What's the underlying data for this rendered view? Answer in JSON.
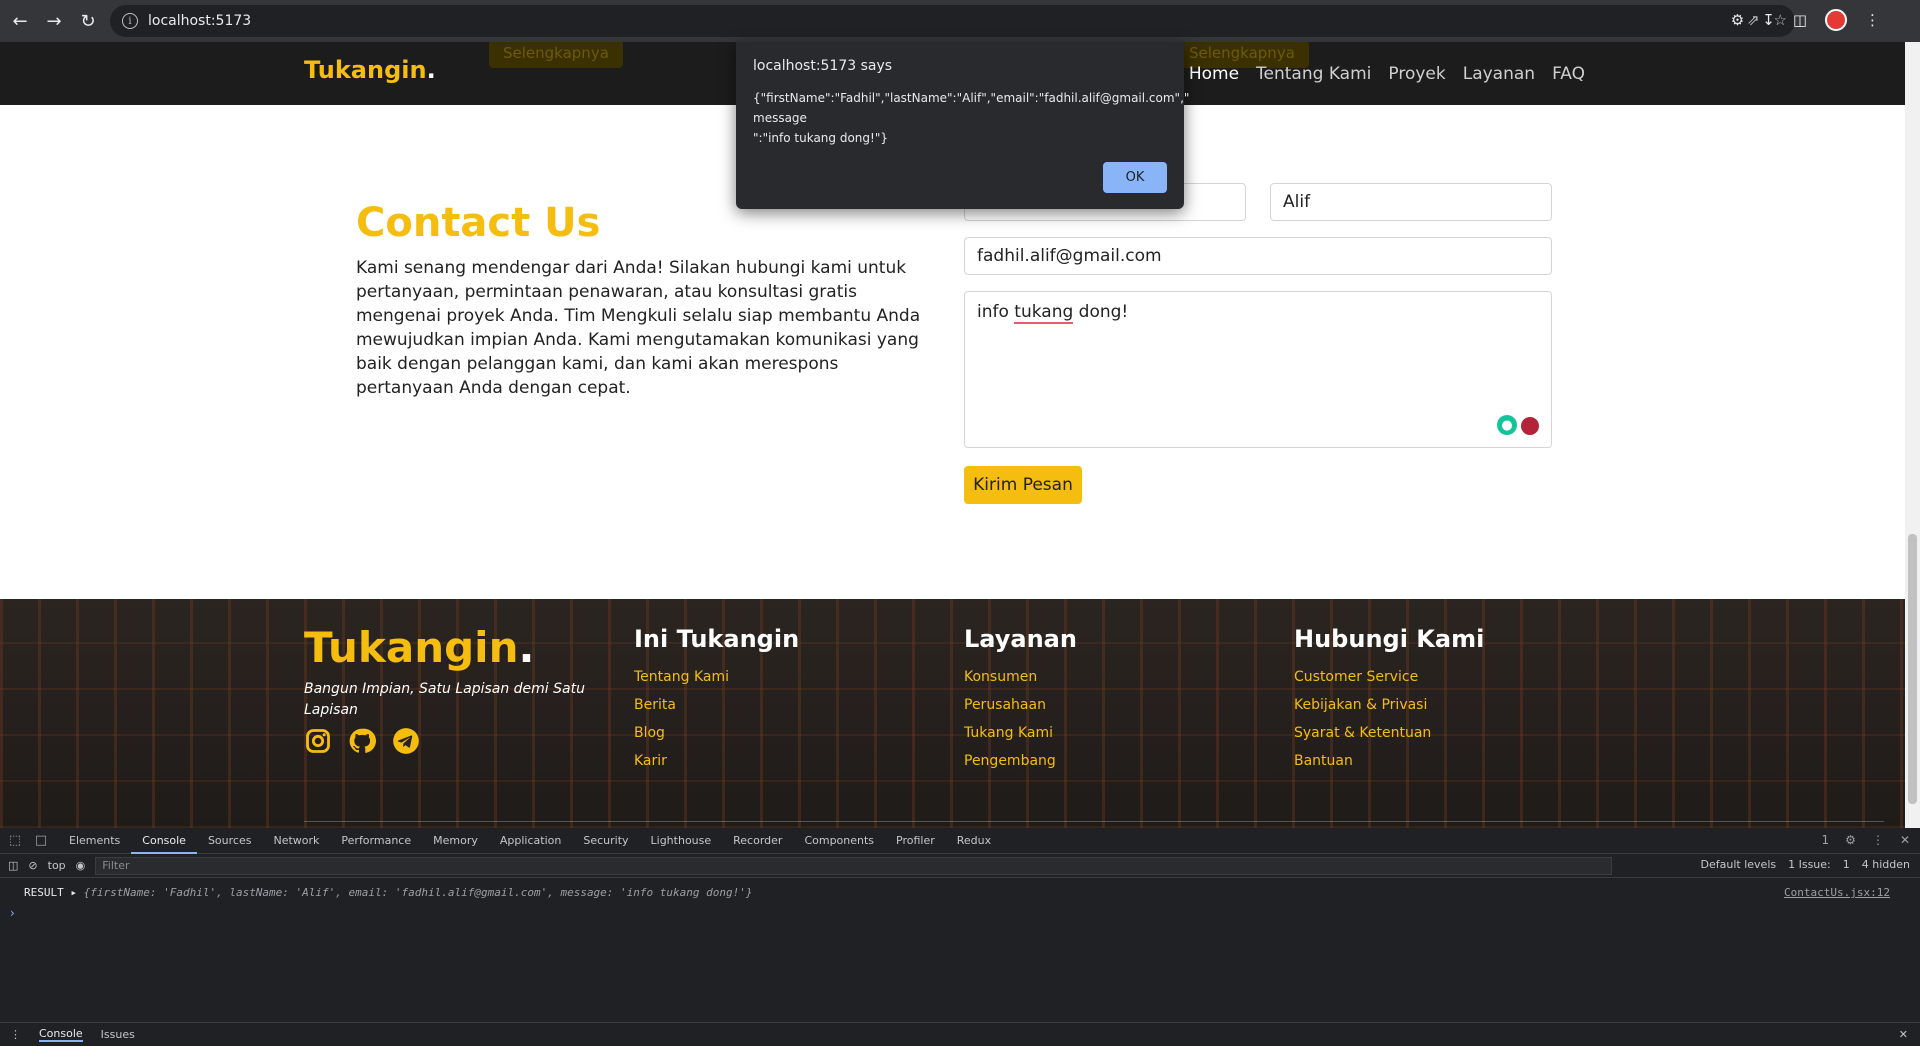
{
  "browser": {
    "url": "localhost:5173"
  },
  "navbar": {
    "brand": "Tukangin",
    "brand_dot": ".",
    "ghost_button_left": "Selengkapnya",
    "ghost_button_right": "Selengkapnya",
    "links": [
      "Home",
      "Tentang Kami",
      "Proyek",
      "Layanan",
      "FAQ"
    ]
  },
  "contact": {
    "title": "Contact Us",
    "description": "Kami senang mendengar dari Anda! Silakan hubungi kami untuk pertanyaan, permintaan penawaran, atau konsultasi gratis mengenai proyek Anda. Tim Mengkuli selalu siap membantu Anda mewujudkan impian Anda. Kami mengutamakan komunikasi yang baik dengan pelanggan kami, dan kami akan merespons pertanyaan Anda dengan cepat.",
    "last_name_value": "Alif",
    "email_value": "fadhil.alif@gmail.com",
    "message_value_pre": "info ",
    "message_value_spell": "tukang",
    "message_value_post": " dong!",
    "submit_label": "Kirim Pesan"
  },
  "footer": {
    "brand": "Tukangin",
    "brand_dot": ".",
    "tagline": "Bangun Impian, Satu Lapisan demi Satu Lapisan",
    "columns": [
      {
        "title": "Ini Tukangin",
        "links": [
          "Tentang Kami",
          "Berita",
          "Blog",
          "Karir"
        ]
      },
      {
        "title": "Layanan",
        "links": [
          "Konsumen",
          "Perusahaan",
          "Tukang Kami",
          "Pengembang"
        ]
      },
      {
        "title": "Hubungi Kami",
        "links": [
          "Customer Service",
          "Kebijakan & Privasi",
          "Syarat & Ketentuan",
          "Bantuan"
        ]
      }
    ]
  },
  "dialog": {
    "origin": "localhost:5173 says",
    "line1": "{\"firstName\":\"Fadhil\",\"lastName\":\"Alif\",\"email\":\"fadhil.alif@gmail.com\",\"",
    "line2": "message",
    "line3": "\":\"info tukang dong!\"}",
    "ok_label": "OK"
  },
  "devtools": {
    "tabs": [
      "Elements",
      "Console",
      "Sources",
      "Network",
      "Performance",
      "Memory",
      "Application",
      "Security",
      "Lighthouse",
      "Recorder",
      "Components",
      "Profiler",
      "Redux"
    ],
    "active_tab": "Console",
    "issues_badge": "1",
    "context": "top",
    "filter_placeholder": "Filter",
    "levels": "Default levels",
    "issue_count": "1 Issue:",
    "issue_badge": "1",
    "hidden": "4 hidden",
    "console_prefix": "RESULT",
    "console_obj": "{firstName: 'Fadhil', lastName: 'Alif', email: 'fadhil.alif@gmail.com', message: 'info tukang dong!'}",
    "console_src": "ContactUs.jsx:12",
    "bottom_tabs": [
      "Console",
      "Issues"
    ]
  }
}
